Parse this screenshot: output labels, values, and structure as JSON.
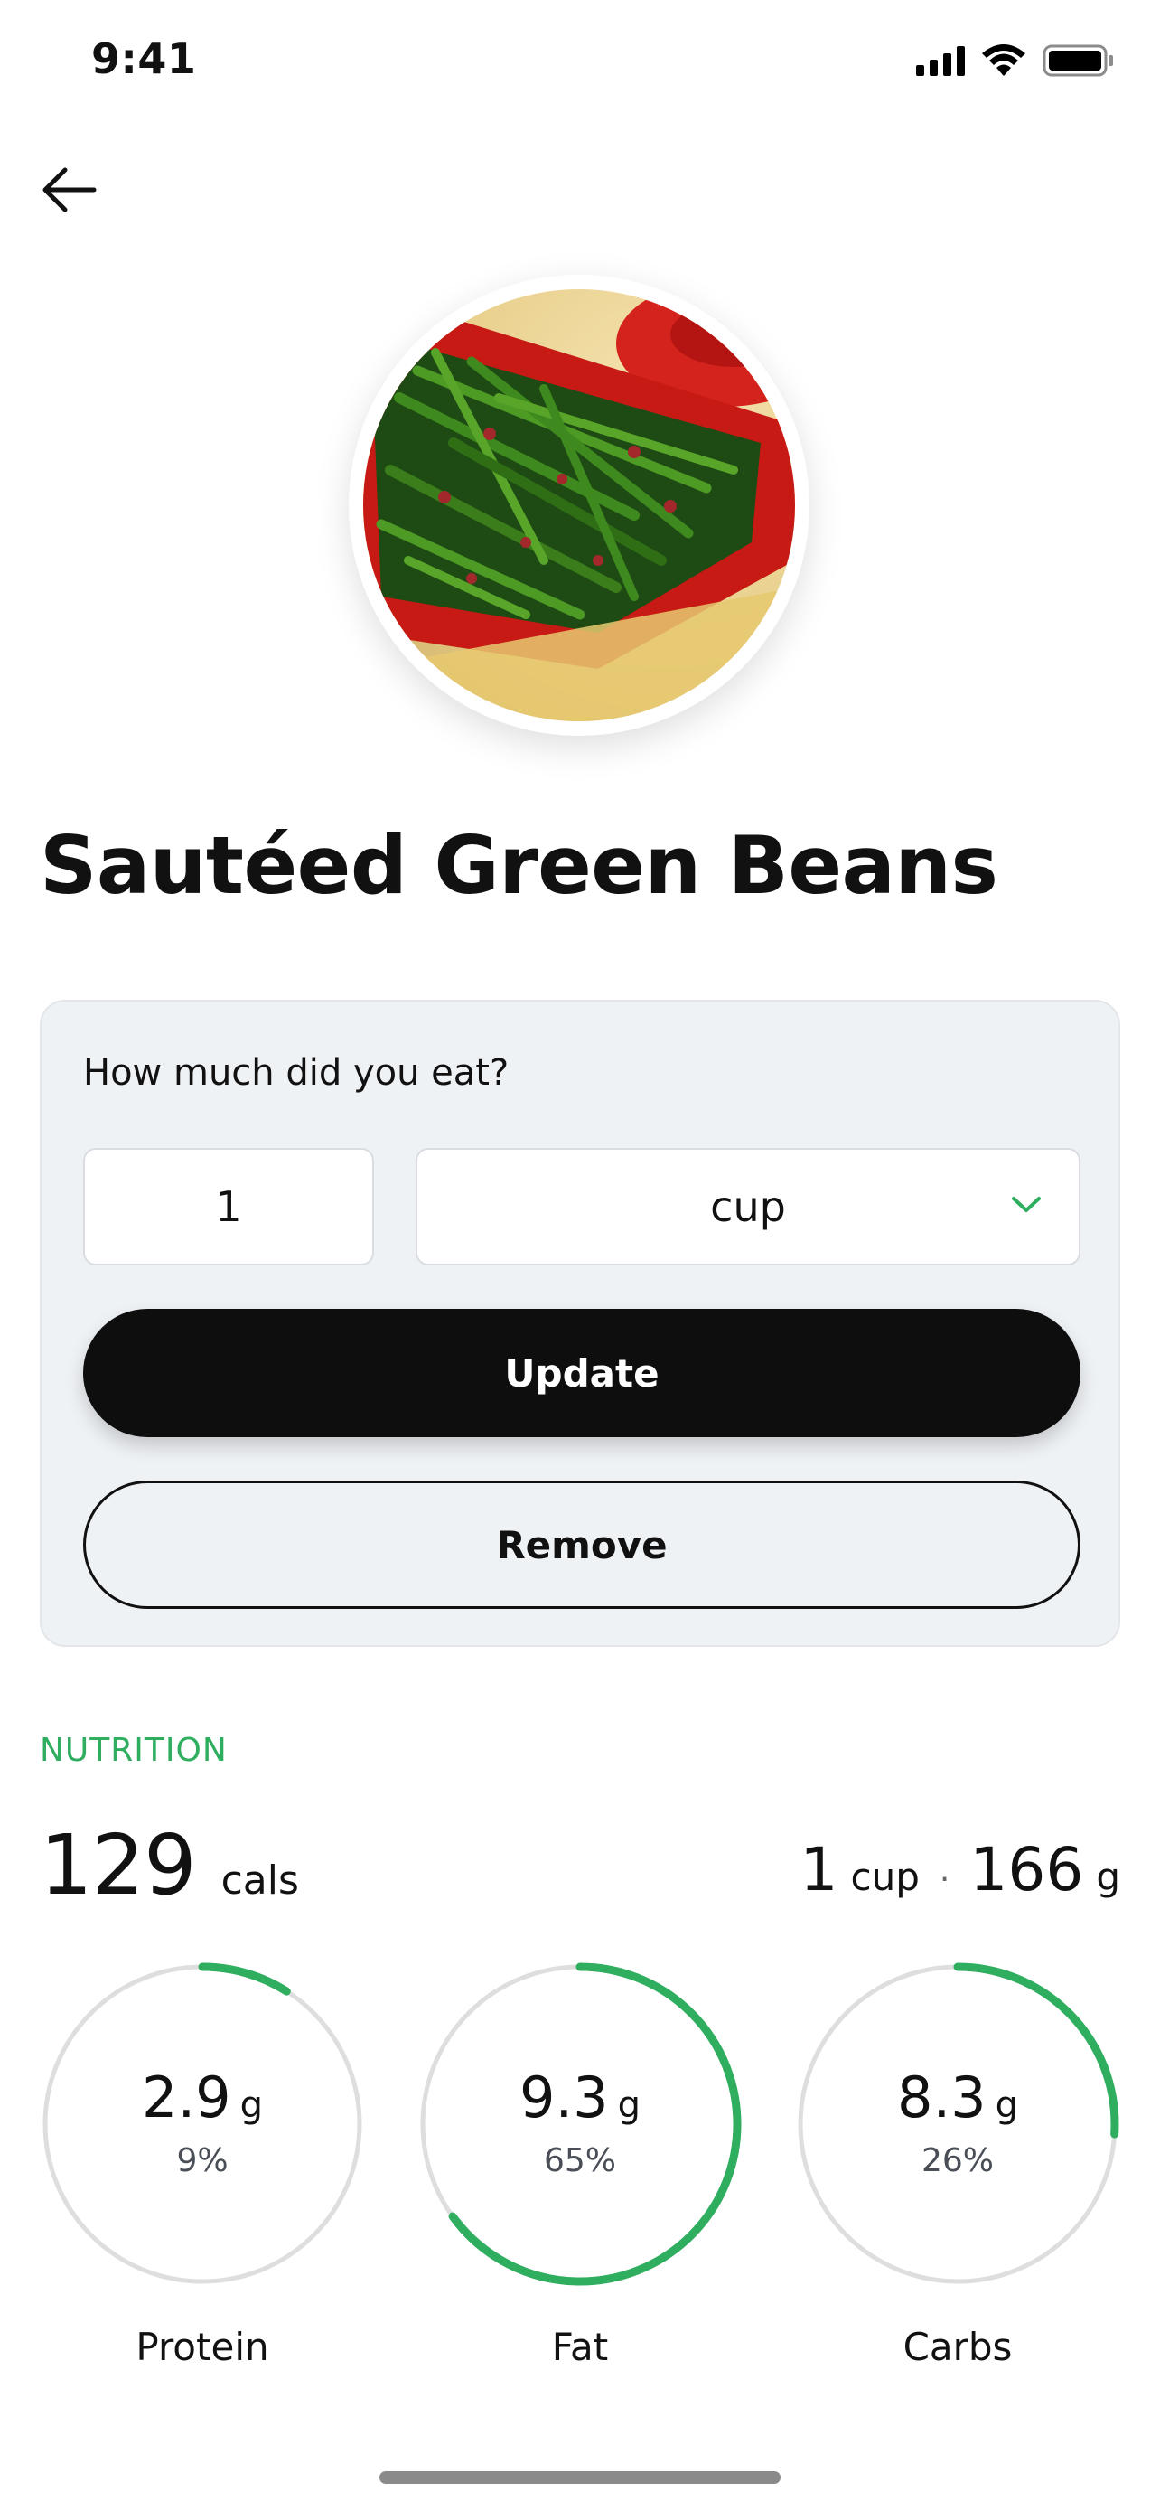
{
  "status_bar": {
    "time": "9:41",
    "icons": [
      "cellular-icon",
      "wifi-icon",
      "battery-icon"
    ]
  },
  "nav": {
    "back_icon": "arrow-left-icon"
  },
  "food": {
    "title": "Sautéed Green Beans",
    "photo": "green-beans-photo"
  },
  "portion": {
    "question": "How much did you eat?",
    "quantity": "1",
    "unit": "cup",
    "update_label": "Update",
    "remove_label": "Remove"
  },
  "nutrition": {
    "section_label": "NUTRITION",
    "calories": "129",
    "calories_unit": "cals",
    "serving_qty": "1",
    "serving_unit": "cup",
    "serving_separator": "·",
    "serving_grams": "166",
    "serving_grams_unit": "g",
    "macros": [
      {
        "name": "Protein",
        "amount": "2.9",
        "unit": "g",
        "percent": "9%",
        "fraction": 0.09
      },
      {
        "name": "Fat",
        "amount": "9.3",
        "unit": "g",
        "percent": "65%",
        "fraction": 0.65
      },
      {
        "name": "Carbs",
        "amount": "8.3",
        "unit": "g",
        "percent": "26%",
        "fraction": 0.26
      }
    ]
  },
  "colors": {
    "accent": "#2fae5f",
    "ring_track": "#dedede",
    "primary_button": "#0e0e0f",
    "card_bg": "#eff2f5"
  }
}
